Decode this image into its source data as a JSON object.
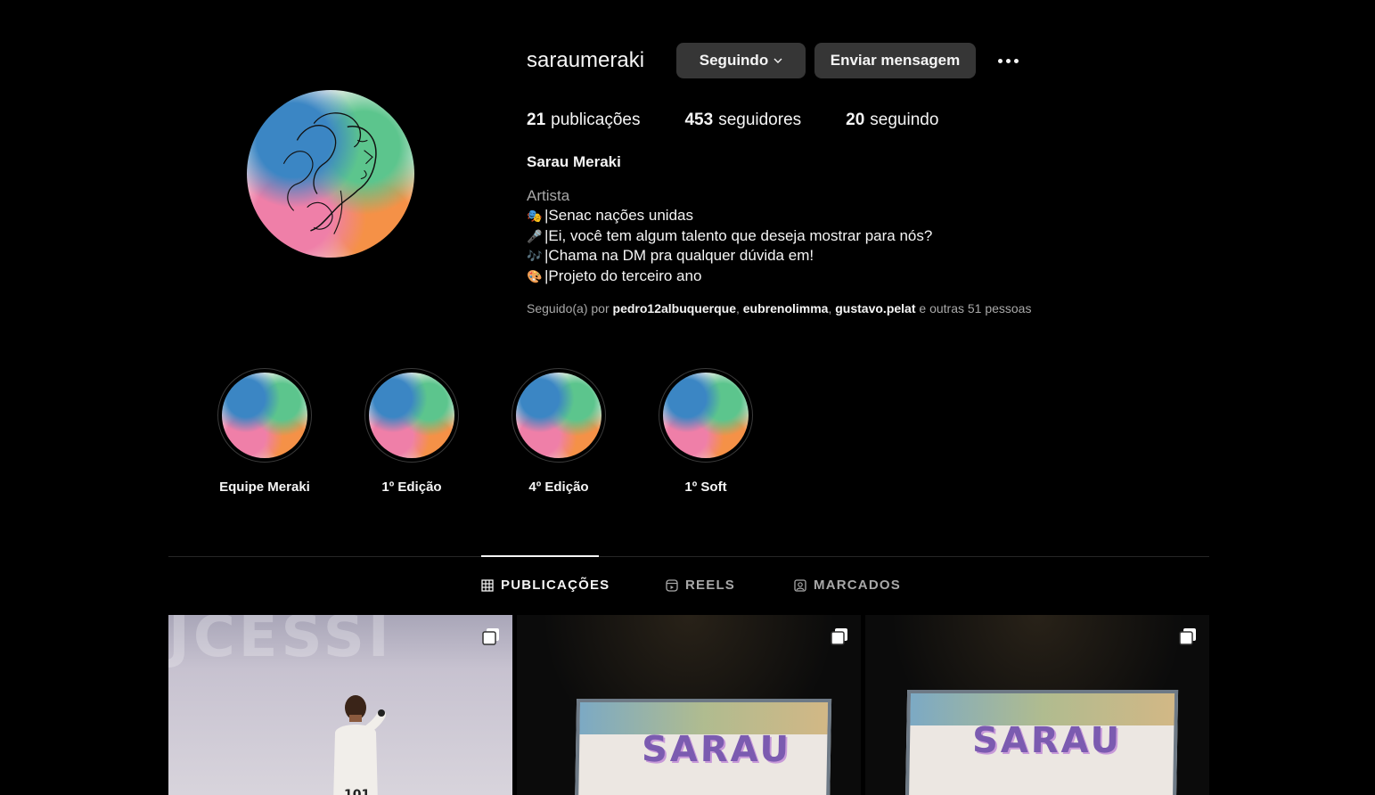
{
  "profile": {
    "username": "saraumeraki",
    "follow_button": "Seguindo",
    "message_button": "Enviar mensagem",
    "stats": {
      "posts_count": "21",
      "posts_label": "publicações",
      "followers_count": "453",
      "followers_label": "seguidores",
      "following_count": "20",
      "following_label": "seguindo"
    },
    "full_name": "Sarau Meraki",
    "category": "Artista",
    "bio": [
      {
        "emoji": "masks",
        "text": "|Senac nações unidas"
      },
      {
        "emoji": "microphone",
        "text": "|Ei, você tem algum talento que deseja mostrar para nós?"
      },
      {
        "emoji": "music-notes",
        "text": "|Chama na DM pra qualquer dúvida em!"
      },
      {
        "emoji": "palette",
        "text": "|Projeto do terceiro ano"
      }
    ],
    "followed_by": {
      "prefix": "Seguido(a) por",
      "users": [
        "pedro12albuquerque",
        "eubrenolimma",
        "gustavo.pelat"
      ],
      "suffix": "e outras 51 pessoas"
    }
  },
  "highlights": [
    {
      "label": "Equipe Meraki"
    },
    {
      "label": "1º Edição"
    },
    {
      "label": "4º Edição"
    },
    {
      "label": "1º Soft"
    }
  ],
  "tabs": [
    {
      "label": "PUBLICAÇÕES",
      "icon": "grid-icon",
      "active": true
    },
    {
      "label": "REELS",
      "icon": "reels-icon",
      "active": false
    },
    {
      "label": "MARCADOS",
      "icon": "tagged-icon",
      "active": false
    }
  ],
  "posts": [
    {
      "type": "carousel",
      "wall_text": "JCESSI"
    },
    {
      "type": "carousel",
      "screen_title": "SARAU"
    },
    {
      "type": "carousel",
      "screen_title": "SARAU"
    }
  ],
  "colors": {
    "background": "#000000",
    "button_bg": "#363636",
    "secondary_text": "#a8a8a8",
    "primary_text": "#f5f5f5"
  }
}
